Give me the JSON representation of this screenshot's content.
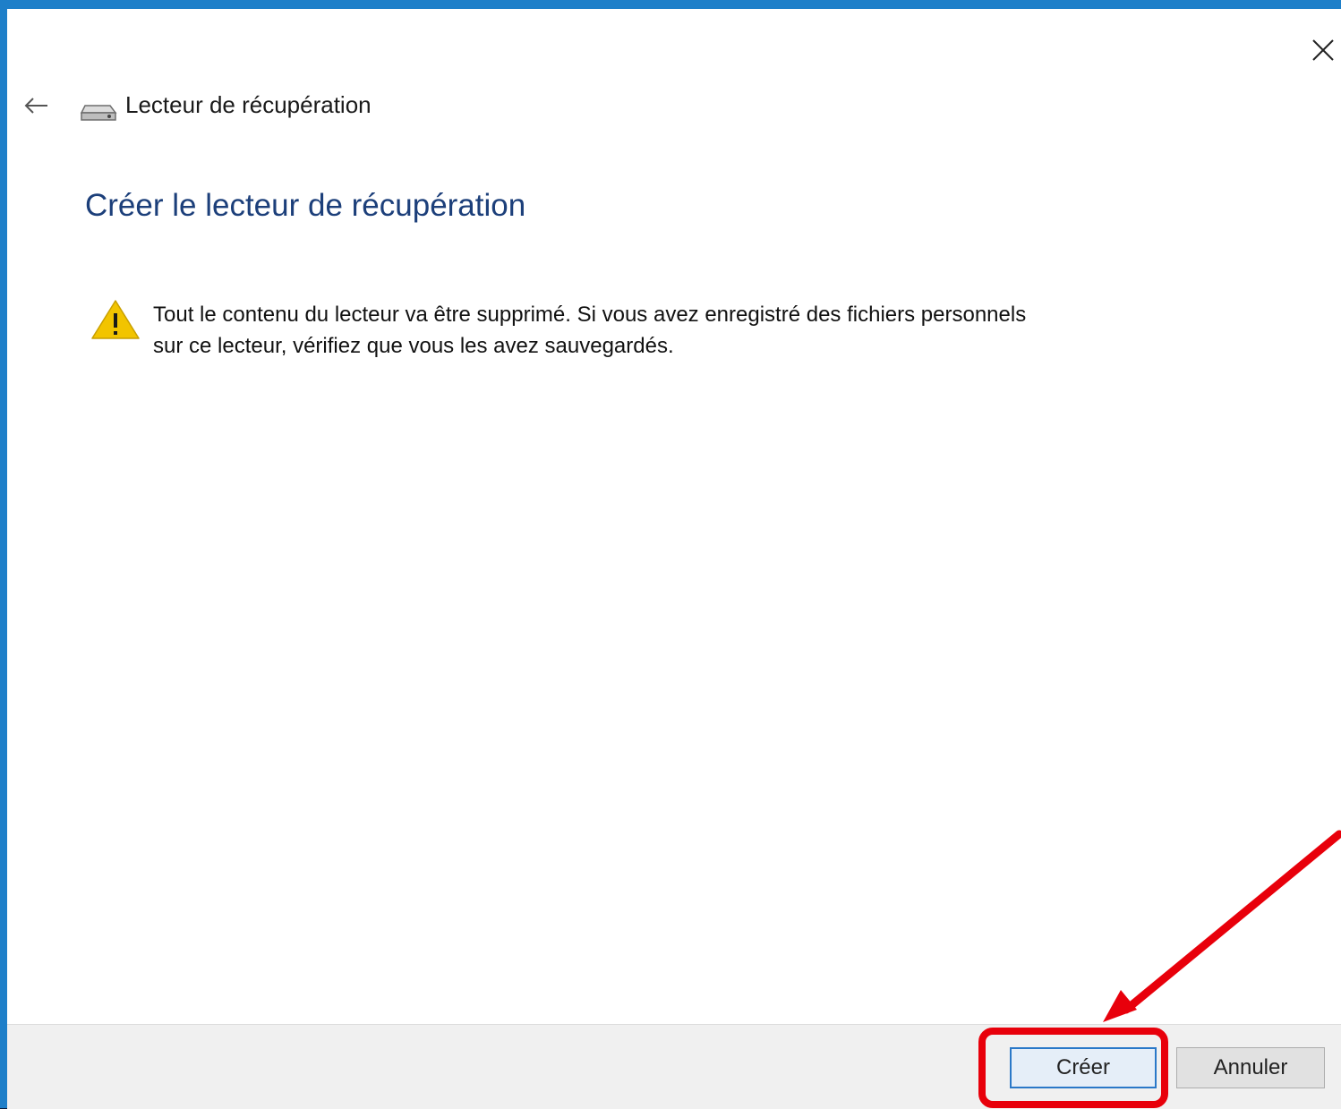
{
  "window": {
    "header_label": "Lecteur de récupération",
    "page_title": "Créer le lecteur de récupération"
  },
  "icons": {
    "close": "close-icon",
    "back": "back-arrow-icon",
    "drive": "drive-icon",
    "warning": "warning-icon"
  },
  "warning": {
    "line1": "Tout le contenu du lecteur va être supprimé. Si vous avez enregistré des fichiers personnels",
    "line2": "sur ce lecteur, vérifiez que vous les avez sauvegardés."
  },
  "buttons": {
    "create": "Créer",
    "cancel": "Annuler"
  },
  "colors": {
    "accent": "#1e7fc9",
    "title": "#1c3f7a",
    "annotation": "#e8000b",
    "warning": "#f2c400"
  }
}
